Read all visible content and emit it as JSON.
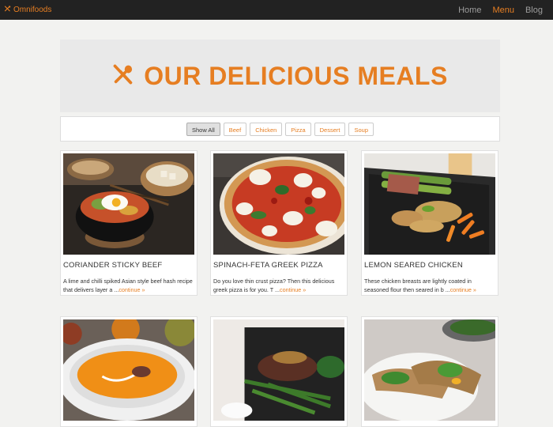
{
  "brand": {
    "name": "Omnifoods",
    "icon": "cutlery-icon"
  },
  "nav": {
    "items": [
      {
        "label": "Home",
        "active": false
      },
      {
        "label": "Menu",
        "active": true
      },
      {
        "label": "Blog",
        "active": false
      }
    ]
  },
  "hero": {
    "title": "OUR DELICIOUS MEALS",
    "icon": "cutlery-icon"
  },
  "filters": [
    {
      "label": "Show All",
      "active": true
    },
    {
      "label": "Beef",
      "active": false
    },
    {
      "label": "Chicken",
      "active": false
    },
    {
      "label": "Pizza",
      "active": false
    },
    {
      "label": "Dessert",
      "active": false
    },
    {
      "label": "Soup",
      "active": false
    }
  ],
  "meals": [
    {
      "title": "CORIANDER STICKY BEEF",
      "description": "A lime and chilli spiked Asian style beef hash recipe that delivers layer a ...",
      "more": "continue »",
      "image": "bibimbap-bowl"
    },
    {
      "title": "SPINACH-FETA GREEK PIZZA",
      "description": "Do you love thin crust pizza? Then this delicious greek pizza is for you. T ...",
      "more": "continue »",
      "image": "pizza"
    },
    {
      "title": "LEMON SEARED CHICKEN",
      "description": "These chicken breasts are lightly coated in seasoned flour then seared in b ...",
      "more": "continue »",
      "image": "chicken-plate"
    },
    {
      "title": "",
      "description": "",
      "more": "",
      "image": "pumpkin-soup"
    },
    {
      "title": "",
      "description": "",
      "more": "",
      "image": "steak-green-beans"
    },
    {
      "title": "",
      "description": "",
      "more": "",
      "image": "wrap-sandwich"
    }
  ],
  "colors": {
    "accent": "#e67e22",
    "navbar": "#222222",
    "hero_bg": "#e9e9e9"
  }
}
